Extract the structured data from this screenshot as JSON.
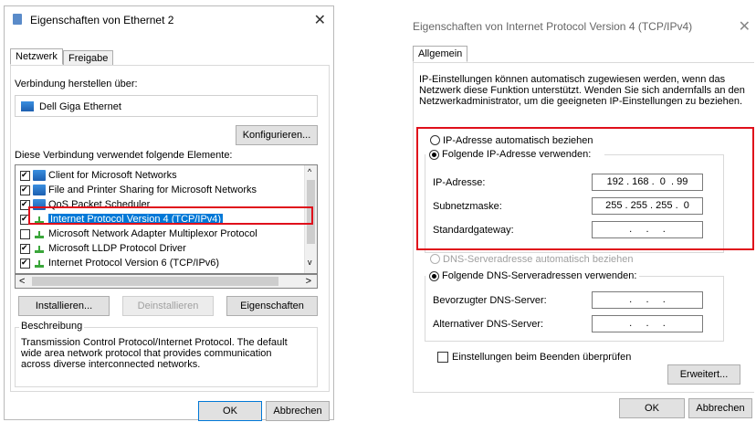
{
  "left_dialog": {
    "title": "Eigenschaften von Ethernet 2",
    "close_glyph": "✕",
    "tabs": [
      "Netzwerk",
      "Freigabe"
    ],
    "connect_via_label": "Verbindung herstellen über:",
    "adapter_name": "Dell Giga Ethernet",
    "configure_button": "Konfigurieren...",
    "elements_label": "Diese Verbindung verwendet folgende Elemente:",
    "items": [
      {
        "label": "Client for Microsoft Networks",
        "checked": true,
        "icon": "network-client-icon"
      },
      {
        "label": "File and Printer Sharing for Microsoft Networks",
        "checked": true,
        "icon": "network-service-icon"
      },
      {
        "label": "QoS Packet Scheduler",
        "checked": true,
        "icon": "network-service-icon"
      },
      {
        "label": "Internet Protocol Version 4 (TCP/IPv4)",
        "checked": true,
        "icon": "protocol-icon",
        "selected": true
      },
      {
        "label": "Microsoft Network Adapter Multiplexor Protocol",
        "checked": false,
        "icon": "protocol-icon"
      },
      {
        "label": "Microsoft LLDP Protocol Driver",
        "checked": true,
        "icon": "protocol-icon"
      },
      {
        "label": "Internet Protocol Version 6 (TCP/IPv6)",
        "checked": true,
        "icon": "protocol-icon"
      }
    ],
    "install_button": "Installieren...",
    "uninstall_button": "Deinstallieren",
    "properties_button": "Eigenschaften",
    "description_label": "Beschreibung",
    "description_text": "Transmission Control Protocol/Internet Protocol. The default wide area network protocol that provides communication across diverse interconnected networks.",
    "ok_button": "OK",
    "cancel_button": "Abbrechen"
  },
  "right_dialog": {
    "title": "Eigenschaften von Internet Protocol Version 4 (TCP/IPv4)",
    "close_glyph": "✕",
    "tab": "Allgemein",
    "intro": "IP-Einstellungen können automatisch zugewiesen werden, wenn das Netzwerk diese Funktion unterstützt. Wenden Sie sich andernfalls an den Netzwerkadministrator, um die geeigneten IP-Einstellungen zu beziehen.",
    "radio_auto_ip": "IP-Adresse automatisch beziehen",
    "radio_manual_ip": "Folgende IP-Adresse verwenden:",
    "ip_label": "IP-Adresse:",
    "ip_value": "192 . 168 .  0  . 99",
    "subnet_label": "Subnetzmaske:",
    "subnet_value": "255 . 255 . 255 .  0",
    "gateway_label": "Standardgateway:",
    "gateway_value": " .     .     . ",
    "radio_auto_dns": "DNS-Serveradresse automatisch beziehen",
    "radio_manual_dns": "Folgende DNS-Serveradressen verwenden:",
    "preferred_dns_label": "Bevorzugter DNS-Server:",
    "preferred_dns_value": " .     .     . ",
    "alternate_dns_label": "Alternativer DNS-Server:",
    "alternate_dns_value": " .     .     . ",
    "validate_checkbox": "Einstellungen beim Beenden überprüfen",
    "advanced_button": "Erweitert...",
    "ok_button": "OK",
    "cancel_button": "Abbrechen"
  },
  "colors": {
    "highlight": "#0078d7",
    "annotation": "#e0101b"
  }
}
